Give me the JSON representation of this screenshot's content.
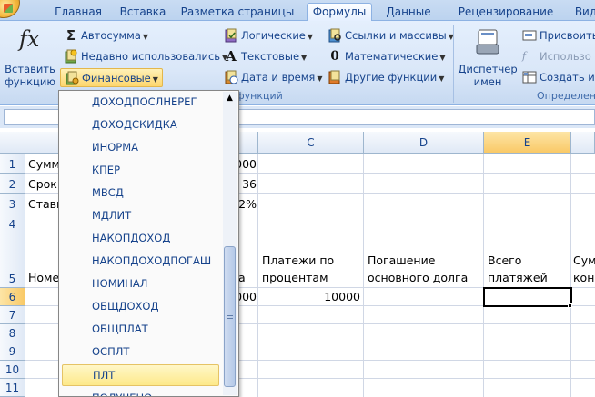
{
  "tabs": [
    "Главная",
    "Вставка",
    "Разметка страницы",
    "Формулы",
    "Данные",
    "Рецензирование",
    "Вид"
  ],
  "active_tab": "Формулы",
  "ribbon": {
    "insert_function": {
      "symbol": "fx",
      "line1": "Вставить",
      "line2": "функцию"
    },
    "autosum": "Автосумма",
    "recent": "Недавно использовались",
    "financial": "Финансовые",
    "logical": "Логические",
    "text": "Текстовые",
    "datetime": "Дата и время",
    "lookup": "Ссылки и массивы",
    "math": "Математические",
    "other": "Другие функции",
    "library_group": "функций",
    "name_manager": {
      "line1": "Диспетчер",
      "line2": "имен"
    },
    "define_name": "Присвоить",
    "use_in_formula": "Использо",
    "create_from_selection": "Создать из",
    "defined_group": "Определен"
  },
  "colors": {
    "accent": "#15428b",
    "ribbon": "#dbe7f7",
    "highlight": "#fde98a"
  },
  "grid": {
    "columns": [
      "C",
      "D",
      "E"
    ],
    "rows": [
      "1",
      "2",
      "3",
      "4",
      "5",
      "6",
      "7",
      "8",
      "9",
      "10",
      "11"
    ],
    "cells": {
      "a1": "Сумм",
      "b1": "000",
      "a2": "Срок",
      "b2": "36",
      "a3": "Ставк",
      "b3": "12%",
      "a5": "Номе",
      "b5": "а",
      "c5_l1": "Платежи по",
      "c5_l2": "процентам",
      "d5_l1": "Погашение",
      "d5_l2": "основного долга",
      "e5_l1": "Всего",
      "e5_l2": "платяжей",
      "f5_l1": "Сум",
      "f5_l2": "кон",
      "b6": "000",
      "c6": "10000"
    }
  },
  "menu": {
    "items": [
      "ДОХОДПОСЛНЕРЕГ",
      "ДОХОДСКИДКА",
      "ИНОРМА",
      "КПЕР",
      "МВСД",
      "МДЛИТ",
      "НАКОПДОХОД",
      "НАКОПДОХОДПОГАШ",
      "НОМИНАЛ",
      "ОБЩДОХОД",
      "ОБЩПЛАТ",
      "ОСПЛТ",
      "ПЛТ",
      "ПОЛУЧЕНО"
    ],
    "highlighted": "ПЛТ"
  }
}
